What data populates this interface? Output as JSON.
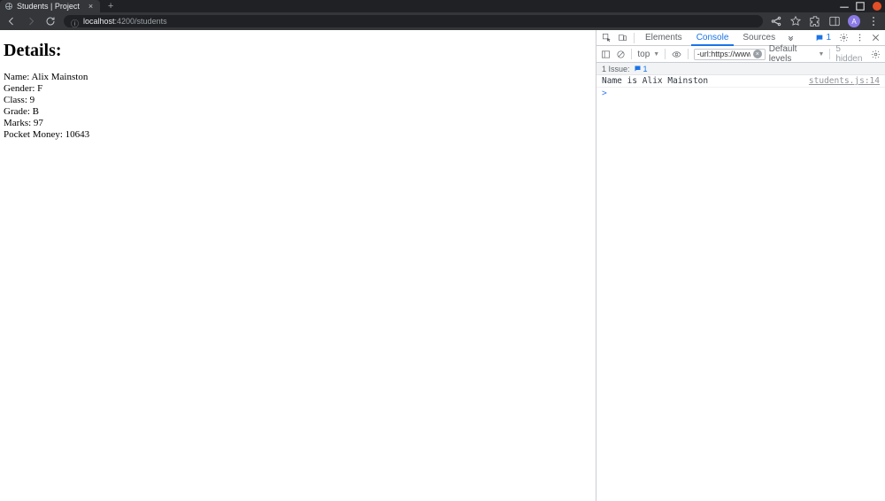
{
  "browser": {
    "tab_title": "Students | Project",
    "url_info_icon": "ⓘ",
    "url_host": "localhost",
    "url_port_path": ":4200/students",
    "avatar_initial": "A"
  },
  "page": {
    "heading": "Details:",
    "lines": [
      "Name: Alix Mainston",
      "Gender: F",
      "Class: 9",
      "Grade: B",
      "Marks: 97",
      "Pocket Money: 10643"
    ]
  },
  "devtools": {
    "tabs": {
      "elements": "Elements",
      "console": "Console",
      "sources": "Sources"
    },
    "messages_badge": "1",
    "context": "top",
    "filter_text": "-url:https://www.ge",
    "default_levels": "Default levels",
    "hidden_text": "5 hidden",
    "issue_label": "1 Issue:",
    "issue_count": "1",
    "console_msg": "Name is Alix Mainston",
    "console_src": "students.js:14",
    "prompt": ">"
  }
}
